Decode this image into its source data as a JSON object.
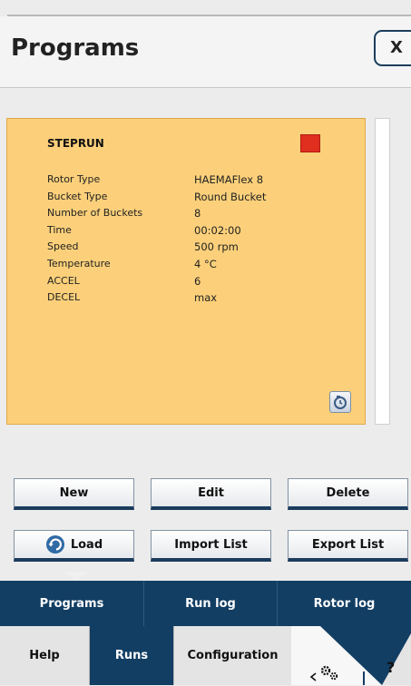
{
  "header": {
    "title": "Programs",
    "close_label": "X"
  },
  "program": {
    "name": "STEPRUN",
    "status_color": "#e02e1f",
    "params": [
      {
        "key": "Rotor Type",
        "value": "HAEMAFlex 8"
      },
      {
        "key": "Bucket Type",
        "value": "Round Bucket"
      },
      {
        "key": "Number of Buckets",
        "value": "8"
      },
      {
        "key": "Time",
        "value": "00:02:00"
      },
      {
        "key": "Speed",
        "value": "500 rpm"
      },
      {
        "key": "Temperature",
        "value": "4 °C"
      },
      {
        "key": "ACCEL",
        "value": "6"
      },
      {
        "key": "DECEL",
        "value": "max"
      }
    ]
  },
  "actions": {
    "new": "New",
    "edit": "Edit",
    "delete": "Delete",
    "load": "Load",
    "import": "Import List",
    "export": "Export List"
  },
  "tabs": [
    "Programs",
    "Run log",
    "Rotor log"
  ],
  "nav": {
    "help": "Help",
    "runs": "Runs",
    "configuration": "Configuration",
    "question": "?"
  },
  "colors": {
    "accent": "#123e63",
    "card": "#fcd07a"
  }
}
